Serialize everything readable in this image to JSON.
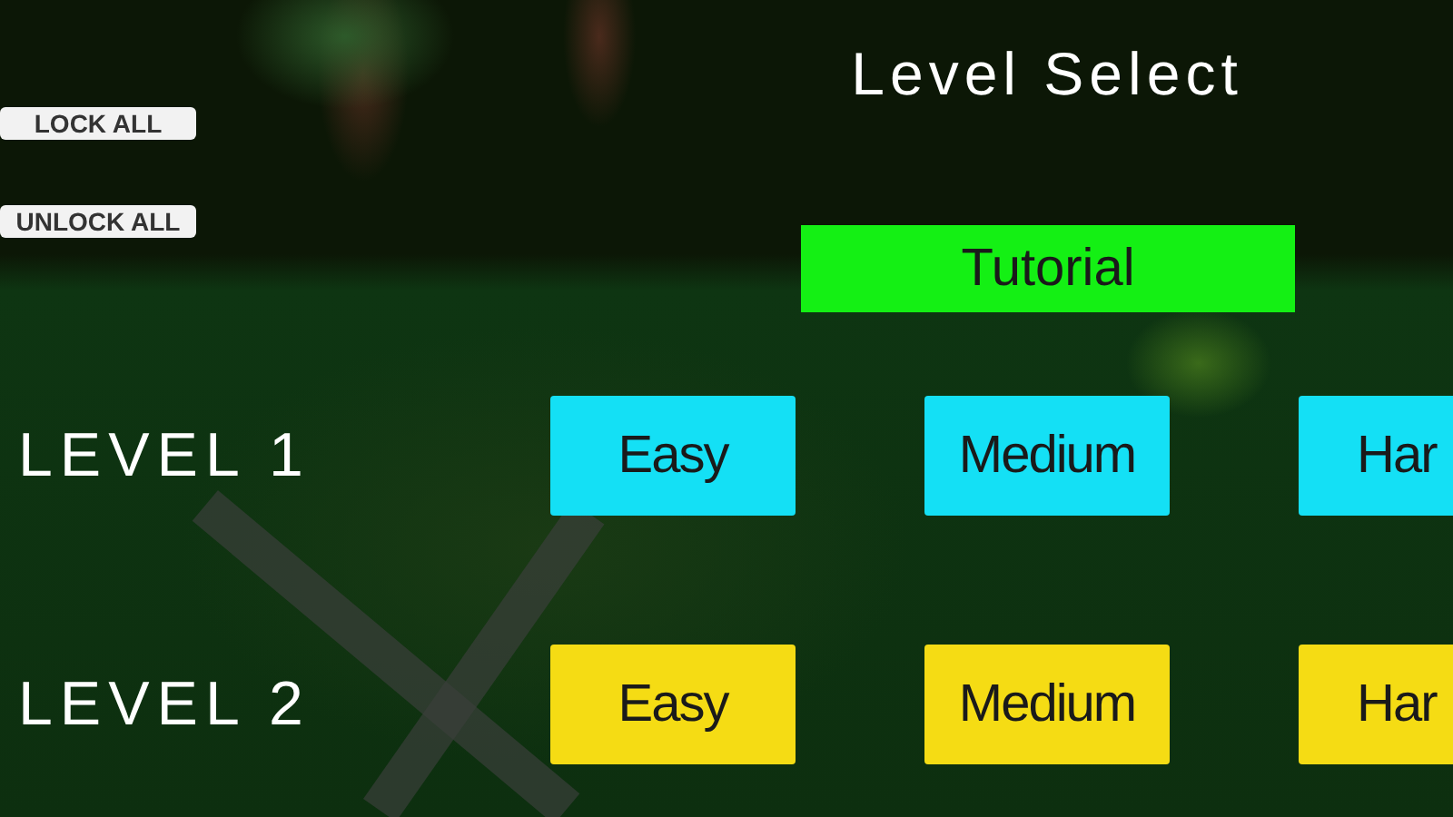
{
  "title": "Level Select",
  "admin_buttons": [
    {
      "label": "LOCK ALL"
    },
    {
      "label": "UNLOCK ALL"
    }
  ],
  "tutorial": {
    "label": "Tutorial",
    "color": "#14f014"
  },
  "levels": [
    {
      "label": "LEVEL 1",
      "color": "#14e0f5",
      "difficulties": [
        "Easy",
        "Medium",
        "Har"
      ]
    },
    {
      "label": "LEVEL 2",
      "color": "#f5dc14",
      "difficulties": [
        "Easy",
        "Medium",
        "Har"
      ]
    }
  ]
}
